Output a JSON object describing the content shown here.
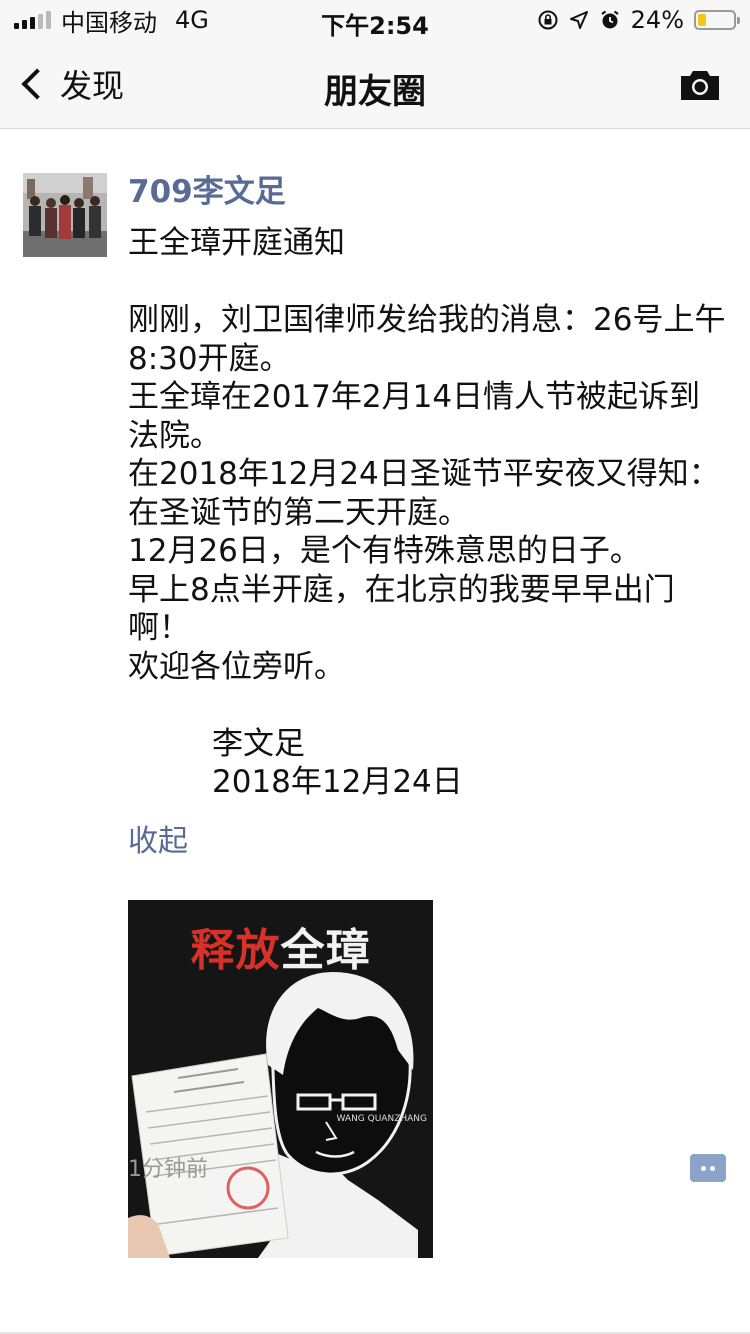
{
  "status_bar": {
    "carrier": "中国移动",
    "network": "4G",
    "time": "下午2:54",
    "battery": "24%",
    "battery_level": 0.24
  },
  "nav": {
    "back_label": "发现",
    "title": "朋友圈"
  },
  "post": {
    "author": "709李文足",
    "lines": [
      "王全璋开庭通知",
      "",
      "刚刚，刘卫国律师发给我的消息：26号上午8:30开庭。",
      "王全璋在2017年2月14日情人节被起诉到法院。",
      "在2018年12月24日圣诞节平安夜又得知：在圣诞节的第二天开庭。",
      "12月26日，是个有特殊意思的日子。",
      "早上8点半开庭，在北京的我要早早出门啊！",
      "欢迎各位旁听。",
      ""
    ],
    "signature_name": "李文足",
    "signature_date": "2018年12月24日",
    "collapse_label": "收起",
    "image": {
      "title_red": "释放",
      "title_white": "全璋",
      "name_caption": "WANG QUANZHANG"
    },
    "time_ago": "1分钟前"
  },
  "colors": {
    "link_blue": "#576b95",
    "bar_bg": "#f7f7f7",
    "accent_red": "#d8312a",
    "battery_yellow": "#f5c518"
  }
}
